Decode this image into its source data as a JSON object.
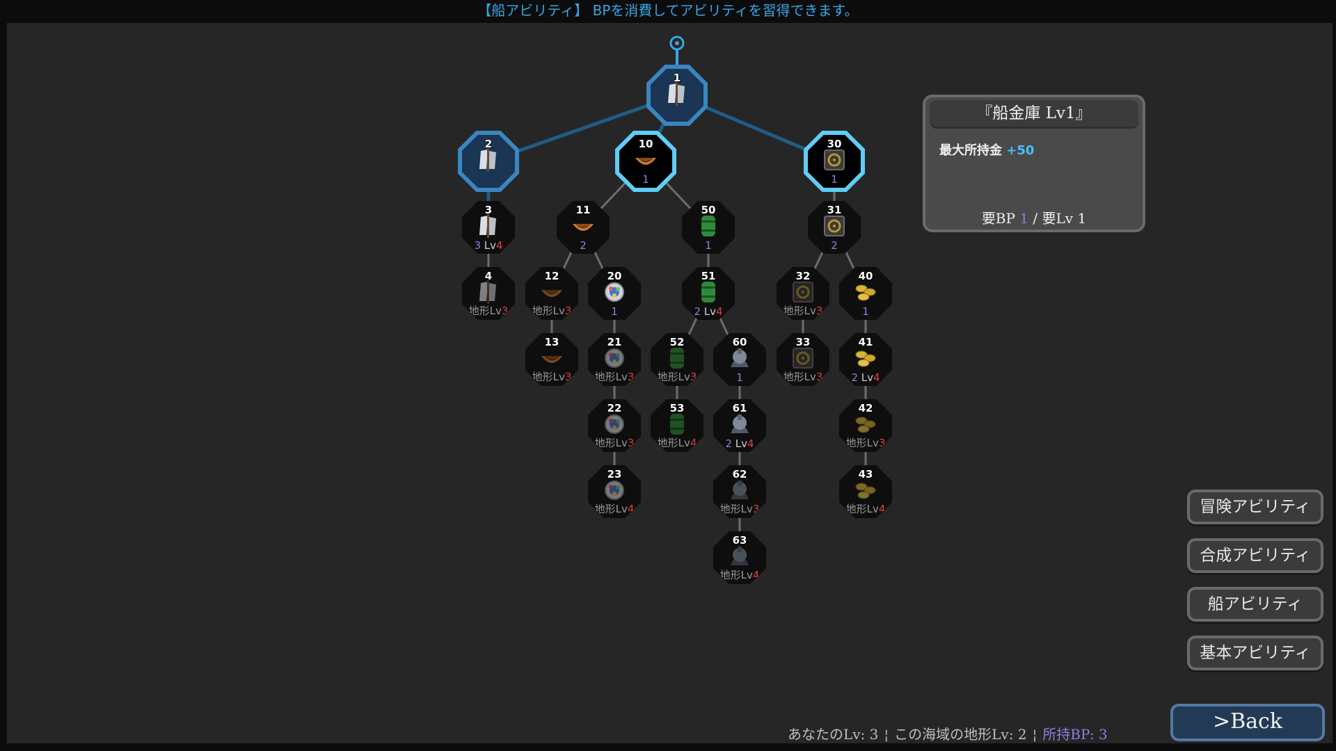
{
  "header": {
    "text": "【船アビリティ】 BPを消費してアビリティを習得できます。"
  },
  "colors": {
    "accent": "#37a6e6",
    "bp": "#8e7fe0",
    "level_red": "#e04040",
    "info_value": "#47c0ff"
  },
  "info": {
    "title": "『船金庫 Lv1』",
    "desc_label": "最大所持金 ",
    "desc_value": "+50",
    "req_bp_label": "要BP ",
    "req_bp_value": "1",
    "req_sep": " / ",
    "req_lv_label": "要Lv 1"
  },
  "menu": {
    "adventure": "冒険アビリティ",
    "synthesis": "合成アビリティ",
    "ship": "船アビリティ",
    "basic": "基本アビリティ",
    "back": ">Back"
  },
  "status": {
    "your_lv": "あなたのLv: 3",
    "sep": "¦",
    "terrain_lv": "この海域の地形Lv: 2",
    "bp": "所持BP: 3"
  },
  "nodes": [
    {
      "id": "1",
      "icon": "sail-icon",
      "state": "acquired"
    },
    {
      "id": "2",
      "icon": "sail-icon",
      "state": "acquired"
    },
    {
      "id": "3",
      "icon": "sail-icon",
      "state": "available",
      "bp": "3",
      "lv": "4"
    },
    {
      "id": "4",
      "icon": "sail-icon",
      "state": "locked",
      "terrain": "3"
    },
    {
      "id": "10",
      "icon": "hull-icon",
      "state": "selectable",
      "bp": "1"
    },
    {
      "id": "11",
      "icon": "hull-icon",
      "state": "available",
      "bp": "2"
    },
    {
      "id": "12",
      "icon": "hull-icon",
      "state": "locked",
      "terrain": "3"
    },
    {
      "id": "13",
      "icon": "hull-icon",
      "state": "locked",
      "terrain": "3"
    },
    {
      "id": "20",
      "icon": "compass-icon",
      "state": "available",
      "bp": "1"
    },
    {
      "id": "21",
      "icon": "compass-icon",
      "state": "locked",
      "terrain": "3"
    },
    {
      "id": "22",
      "icon": "compass-icon",
      "state": "locked",
      "terrain": "3"
    },
    {
      "id": "23",
      "icon": "compass-icon",
      "state": "locked",
      "terrain": "4"
    },
    {
      "id": "30",
      "icon": "safe-icon",
      "state": "selected",
      "bp": "1"
    },
    {
      "id": "31",
      "icon": "safe-icon",
      "state": "available",
      "bp": "2"
    },
    {
      "id": "32",
      "icon": "safe-icon",
      "state": "locked",
      "terrain": "3"
    },
    {
      "id": "33",
      "icon": "safe-icon",
      "state": "locked",
      "terrain": "3"
    },
    {
      "id": "40",
      "icon": "gold-icon",
      "state": "available",
      "bp": "1"
    },
    {
      "id": "41",
      "icon": "gold-icon",
      "state": "available",
      "bp": "2",
      "lv": "4"
    },
    {
      "id": "42",
      "icon": "gold-icon",
      "state": "locked",
      "terrain": "3"
    },
    {
      "id": "43",
      "icon": "gold-icon",
      "state": "locked",
      "terrain": "4"
    },
    {
      "id": "50",
      "icon": "barrel-icon",
      "state": "available",
      "bp": "1"
    },
    {
      "id": "51",
      "icon": "barrel-icon",
      "state": "available",
      "bp": "2",
      "lv": "4"
    },
    {
      "id": "52",
      "icon": "barrel-icon",
      "state": "locked",
      "terrain": "3"
    },
    {
      "id": "53",
      "icon": "barrel-icon",
      "state": "locked",
      "terrain": "4"
    },
    {
      "id": "60",
      "icon": "cannon-icon",
      "state": "available",
      "bp": "1"
    },
    {
      "id": "61",
      "icon": "cannon-icon",
      "state": "available",
      "bp": "2",
      "lv": "4"
    },
    {
      "id": "62",
      "icon": "cannon-icon",
      "state": "locked",
      "terrain": "3"
    },
    {
      "id": "63",
      "icon": "cannon-icon",
      "state": "locked",
      "terrain": "4"
    }
  ]
}
